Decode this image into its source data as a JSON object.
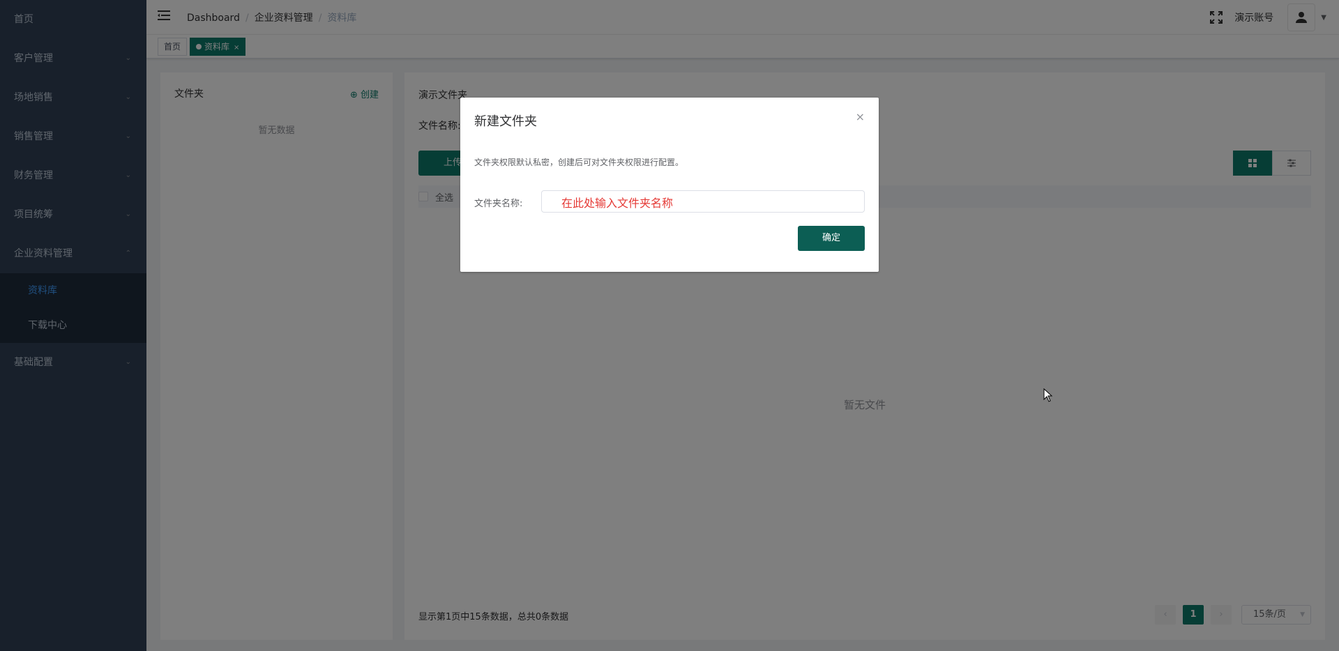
{
  "sidebar": {
    "items": [
      {
        "label": "首页"
      },
      {
        "label": "客户管理"
      },
      {
        "label": "场地销售"
      },
      {
        "label": "销售管理"
      },
      {
        "label": "财务管理"
      },
      {
        "label": "项目统筹"
      },
      {
        "label": "企业资料管理"
      }
    ],
    "submenu": [
      {
        "label": "资料库"
      },
      {
        "label": "下载中心"
      }
    ],
    "last_item": {
      "label": "基础配置"
    }
  },
  "navbar": {
    "breadcrumb": [
      "Dashboard",
      "企业资料管理",
      "资料库"
    ],
    "account_name": "演示账号"
  },
  "tags": [
    {
      "label": "首页"
    },
    {
      "label": "资料库",
      "close": "×"
    }
  ],
  "left_panel": {
    "title": "文件夹",
    "create_label": "创建",
    "empty_text": "暂无数据"
  },
  "right_panel": {
    "folder_title": "演示文件夹",
    "file_name_label": "文件名称:",
    "upload_label": "上传",
    "select_all_label": "全选",
    "empty_text": "暂无文件",
    "footer_info": "显示第1页中15条数据，总共0条数据",
    "pagination": {
      "prev": "‹",
      "current_page": "1",
      "next": "›",
      "page_size": "15条/页"
    }
  },
  "dialog": {
    "title": "新建文件夹",
    "close": "×",
    "description": "文件夹权限默认私密，创建后可对文件夹权限进行配置。",
    "field_label": "文件夹名称:",
    "input_placeholder": "在此处输入文件夹名称",
    "confirm_label": "确定"
  },
  "colors": {
    "accent": "#0c7a6b",
    "sidebar_bg": "#304156",
    "placeholder_red": "#e53935"
  }
}
